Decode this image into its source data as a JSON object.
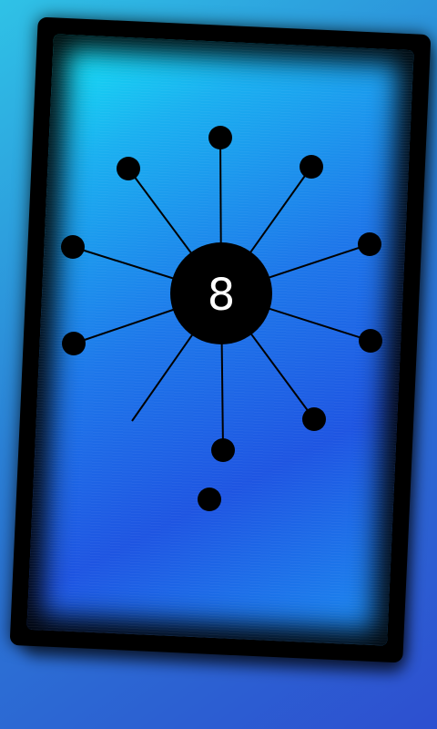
{
  "game": {
    "level_number": "8",
    "colors": {
      "background_top": "#2fc2e6",
      "background_bottom": "#2d4fd0",
      "board_frame": "#000000",
      "board_glow_cyan": "#14e6f4",
      "board_blue": "#1e55e2",
      "pin_color": "#000000",
      "core_text": "#ffffff"
    },
    "pins_attached": 11,
    "pins_waiting": 1,
    "empty_spokes": 1
  }
}
